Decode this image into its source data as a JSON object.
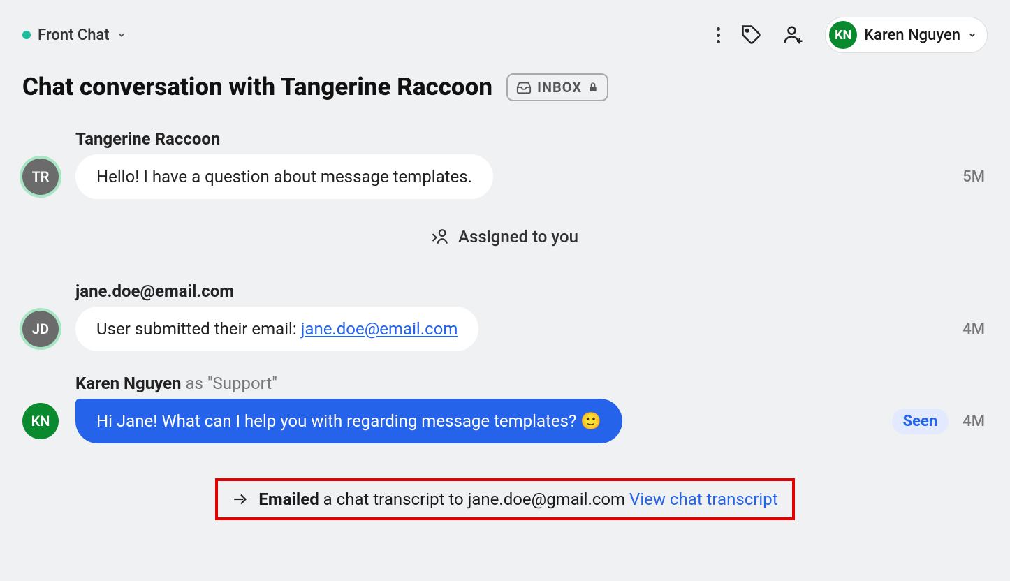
{
  "channel": {
    "name": "Front Chat"
  },
  "currentUser": {
    "initials": "KN",
    "name": "Karen Nguyen"
  },
  "title": "Chat conversation with Tangerine Raccoon",
  "inboxBadge": "INBOX",
  "messages": [
    {
      "sender": "Tangerine Raccoon",
      "avatarInitials": "TR",
      "text": "Hello! I have a question about message templates.",
      "timestamp": "5M"
    },
    {
      "sender": "jane.doe@email.com",
      "avatarInitials": "JD",
      "prefix": "User submitted their email: ",
      "emailLink": "jane.doe@email.com",
      "timestamp": "4M"
    },
    {
      "sender": "Karen Nguyen",
      "roleSuffix": " as \"Support\"",
      "avatarInitials": "KN",
      "text": "Hi Jane! What can I help you with regarding message templates? 🙂",
      "seen": "Seen",
      "timestamp": "4M"
    }
  ],
  "assignedText": "Assigned to you",
  "transcript": {
    "emailedLabel": "Emailed",
    "body": " a chat transcript to jane.doe@gmail.com ",
    "link": "View chat transcript"
  }
}
